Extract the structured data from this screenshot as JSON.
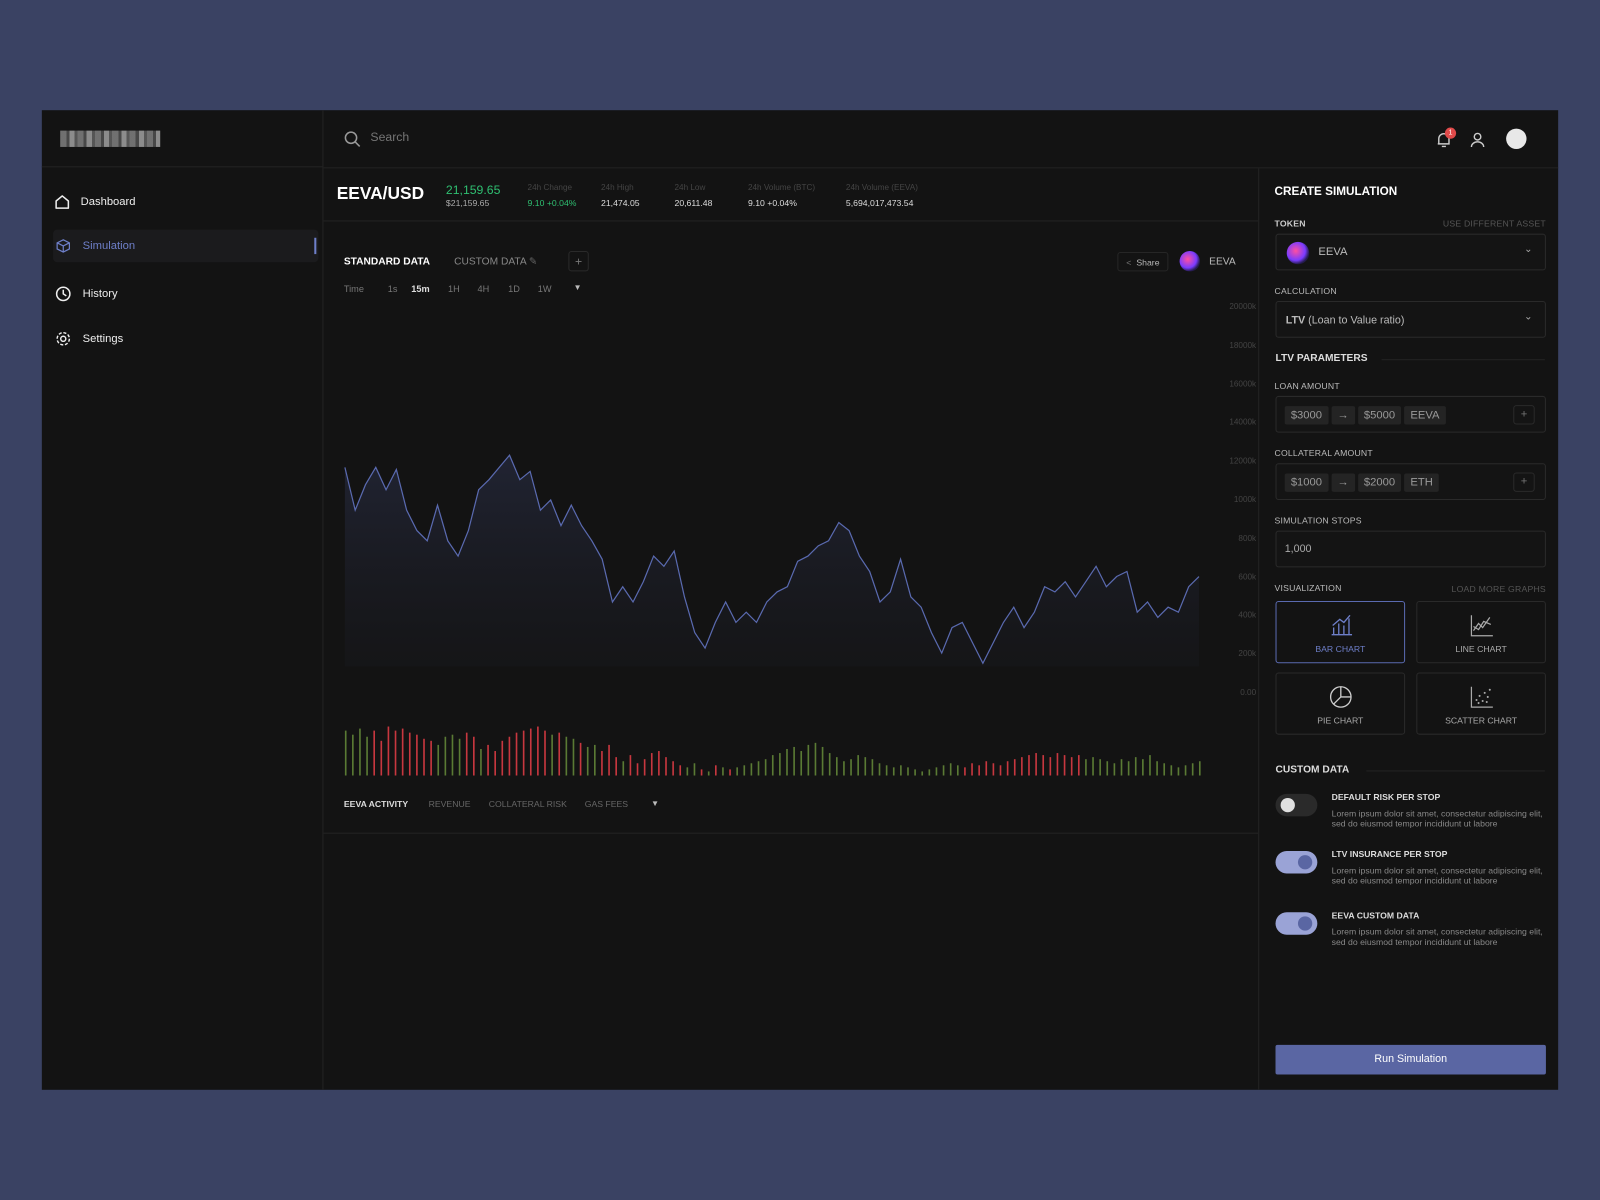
{
  "sidebar": {
    "logo_text": "NUMMAL",
    "items": [
      {
        "label": "Dashboard",
        "icon": "home-icon"
      },
      {
        "label": "Simulation",
        "icon": "cube-icon",
        "active": true
      },
      {
        "label": "History",
        "icon": "history-icon"
      },
      {
        "label": "Settings",
        "icon": "gear-icon"
      }
    ]
  },
  "topbar": {
    "search_placeholder": "Search",
    "notification_count": "1"
  },
  "ticker": {
    "pair": "EEVA/USD",
    "price": "21,159.65",
    "price_usd": "$21,159.65",
    "stats": [
      {
        "label": "24h Change",
        "value": "9.10 +0.04%",
        "positive": true
      },
      {
        "label": "24h High",
        "value": "21,474.05"
      },
      {
        "label": "24h Low",
        "value": "20,611.48"
      },
      {
        "label": "24h Volume (BTC)",
        "value": "9.10 +0.04%"
      },
      {
        "label": "24h Volume (EEVA)",
        "value": "5,694,017,473.54"
      }
    ]
  },
  "chart_tabs": {
    "standard": "STANDARD DATA",
    "custom": "CUSTOM DATA",
    "add": "+",
    "share": "Share",
    "token": "EEVA"
  },
  "timeframes": [
    "Time",
    "1s",
    "15m",
    "1H",
    "4H",
    "1D",
    "1W"
  ],
  "bottom_tabs": [
    "EEVA ACTIVITY",
    "REVENUE",
    "COLLATERAL RISK",
    "GAS FEES"
  ],
  "chart_data": {
    "type": "area",
    "y_ticks": [
      "20000k",
      "18000k",
      "16000k",
      "14000k",
      "12000k",
      "1000k",
      "800k",
      "600k",
      "400k",
      "200k",
      "0.00"
    ],
    "values": [
      1164,
      942,
      1074,
      1164,
      1048,
      1153,
      942,
      836,
      783,
      968,
      783,
      704,
      836,
      1048,
      1100,
      1164,
      1227,
      1100,
      1143,
      942,
      995,
      862,
      968,
      862,
      783,
      688,
      466,
      545,
      466,
      571,
      704,
      651,
      730,
      492,
      307,
      227,
      360,
      466,
      360,
      413,
      360,
      466,
      518,
      545,
      677,
      704,
      757,
      783,
      878,
      836,
      704,
      624,
      466,
      518,
      688,
      492,
      439,
      307,
      201,
      333,
      360,
      254,
      148,
      254,
      360,
      439,
      333,
      413,
      545,
      518,
      571,
      492,
      571,
      651,
      545,
      598,
      624,
      413,
      466,
      386,
      439,
      413,
      545,
      598
    ],
    "line_color": "#5a6ab0",
    "volume": [
      44,
      40,
      46,
      38,
      44,
      34,
      48,
      44,
      46,
      42,
      40,
      36,
      34,
      30,
      38,
      40,
      36,
      42,
      38,
      26,
      30,
      24,
      34,
      38,
      42,
      44,
      46,
      48,
      44,
      40,
      42,
      38,
      36,
      32,
      28,
      30,
      24,
      30,
      18,
      14,
      20,
      12,
      16,
      22,
      24,
      18,
      14,
      10,
      8,
      12,
      6,
      4,
      10,
      8,
      6,
      8,
      10,
      12,
      14,
      16,
      20,
      22,
      26,
      28,
      24,
      30,
      32,
      28,
      22,
      18,
      14,
      16,
      20,
      18,
      16,
      12,
      10,
      8,
      10,
      8,
      6,
      4,
      6,
      8,
      10,
      12,
      10,
      8,
      12,
      10,
      14,
      12,
      10,
      14,
      16,
      18,
      20,
      22,
      20,
      18,
      22,
      20,
      18,
      20,
      16,
      18,
      16,
      14,
      12,
      16,
      14,
      18,
      16,
      20,
      14,
      12,
      10,
      8,
      10,
      12,
      14
    ],
    "volume_dir": "uuuuddddddddduuuudduddddddddduduuduudddudddddddduudududuuuuuuuuuuuuuuuuuuuuuuuuuuuuuuuuddddddddddddddddduuuuuuuuuuuuuuuu",
    "up_color": "#5a7a34",
    "down_color": "#c7373f"
  },
  "panel": {
    "title": "CREATE SIMULATION",
    "token_label": "TOKEN",
    "token_alt": "USE DIFFERENT ASSET",
    "token_value": "EEVA",
    "calc_label": "CALCULATION",
    "calc_bold": "LTV",
    "calc_rest": "(Loan to Value ratio)",
    "params_title": "LTV PARAMETERS",
    "loan_label": "LOAN AMOUNT",
    "loan": [
      "$3000",
      "→",
      "$5000",
      "EEVA"
    ],
    "coll_label": "COLLATERAL AMOUNT",
    "coll": [
      "$1000",
      "→",
      "$2000",
      "ETH"
    ],
    "stops_label": "SIMULATION STOPS",
    "stops_value": "1,000",
    "vis_label": "VISUALIZATION",
    "vis_more": "LOAD MORE GRAPHS",
    "vis": [
      {
        "label": "BAR CHART",
        "selected": true
      },
      {
        "label": "LINE CHART"
      },
      {
        "label": "PIE CHART"
      },
      {
        "label": "SCATTER CHART"
      }
    ],
    "custom_title": "CUSTOM DATA",
    "toggles": [
      {
        "title": "DEFAULT RISK PER STOP",
        "desc": "Lorem ipsum dolor sit amet, consectetur adipiscing elit, sed do eiusmod tempor incididunt ut labore",
        "on": false
      },
      {
        "title": "LTV INSURANCE PER STOP",
        "desc": "Lorem ipsum dolor sit amet, consectetur adipiscing elit, sed do eiusmod tempor incididunt ut labore",
        "on": true
      },
      {
        "title": "EEVA CUSTOM DATA",
        "desc": "Lorem ipsum dolor sit amet, consectetur adipiscing elit, sed do eiusmod tempor incididunt ut labore",
        "on": true
      }
    ],
    "run": "Run Simulation"
  }
}
